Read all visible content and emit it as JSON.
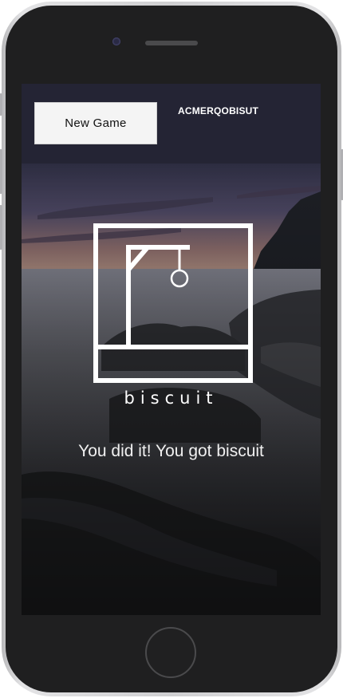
{
  "header": {
    "new_game_label": "New Game",
    "word_code": "ACMERQOBISUT"
  },
  "game": {
    "word": "biscuit",
    "result_message": "You did it! You got biscuit"
  },
  "colors": {
    "header_bg": "#242434",
    "phone_frame": "#1f1f20",
    "accent_text": "#ffffff"
  },
  "icons": {
    "gallows": "hangman-gallows-icon",
    "home": "home-button-icon"
  }
}
